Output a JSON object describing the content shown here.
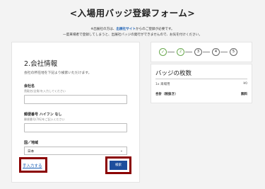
{
  "page": {
    "title": "<入場用バッジ登録フォーム>"
  },
  "notice": {
    "line1_prefix": "※出展社の方は、",
    "line1_link": "出展社サイト",
    "line1_suffix": "からのご登録が必要です。",
    "line2": "一度来場者で登録してしまうと、出展社バッジの発行ができませんので、お気を付けください。"
  },
  "form": {
    "section_title": "2.会社情報",
    "section_subtitle": "会社の所在地を下記より検索いただけます。",
    "company_name": {
      "label": "会社名",
      "hint": "貴殿名(全角)を入力してください",
      "value": ""
    },
    "postal_code": {
      "label": "郵便番号 ハイフン なし",
      "hint": "郵便番号(7桁)をご記入ください",
      "value": ""
    },
    "country": {
      "label": "国／地域",
      "selected": "日本"
    },
    "manual_link": "手入力する",
    "search_button": "検索"
  },
  "steps": {
    "items": [
      {
        "label": "✓",
        "state": "done"
      },
      {
        "label": "2",
        "state": "active"
      },
      {
        "label": "3",
        "state": "todo"
      },
      {
        "label": "4",
        "state": "todo"
      },
      {
        "label": "5",
        "state": "todo"
      }
    ]
  },
  "badges": {
    "title": "バッジの枚数",
    "row1_label": "1x 来場用",
    "row1_value": "¥0",
    "row2_label": "合計（税抜き）",
    "row2_value": "無料"
  }
}
